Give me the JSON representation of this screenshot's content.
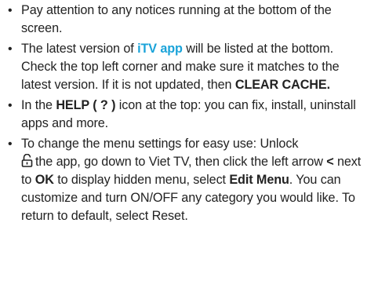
{
  "bullets": [
    {
      "text": "Pay attention to any notices running at the bottom of the screen."
    },
    {
      "part1": "The latest version of ",
      "brand": "iTV app",
      "part2": " will be listed at the bottom. Check the top left corner and make sure it matches to the latest version. If it is not updated, then ",
      "bold": "CLEAR CACHE."
    },
    {
      "part1": "In the ",
      "bold": "HELP ( ? )",
      "part2": "  icon at the top: you can fix, install, uninstall apps and more."
    },
    {
      "part1": "To change the menu settings for easy use: Unlock ",
      "icon": "unlock-icon",
      "part2": "the app, go down to Viet TV, then click the left arrow ",
      "arrow": "<",
      "part3": " next to ",
      "ok": "OK",
      "part4": " to display hidden menu, select ",
      "edit": "Edit Menu",
      "part5": ". You can customize and turn ON/OFF any category you would like. To return to default, select Reset."
    }
  ],
  "colors": {
    "text": "#222222",
    "brand": "#1aa3d9"
  }
}
